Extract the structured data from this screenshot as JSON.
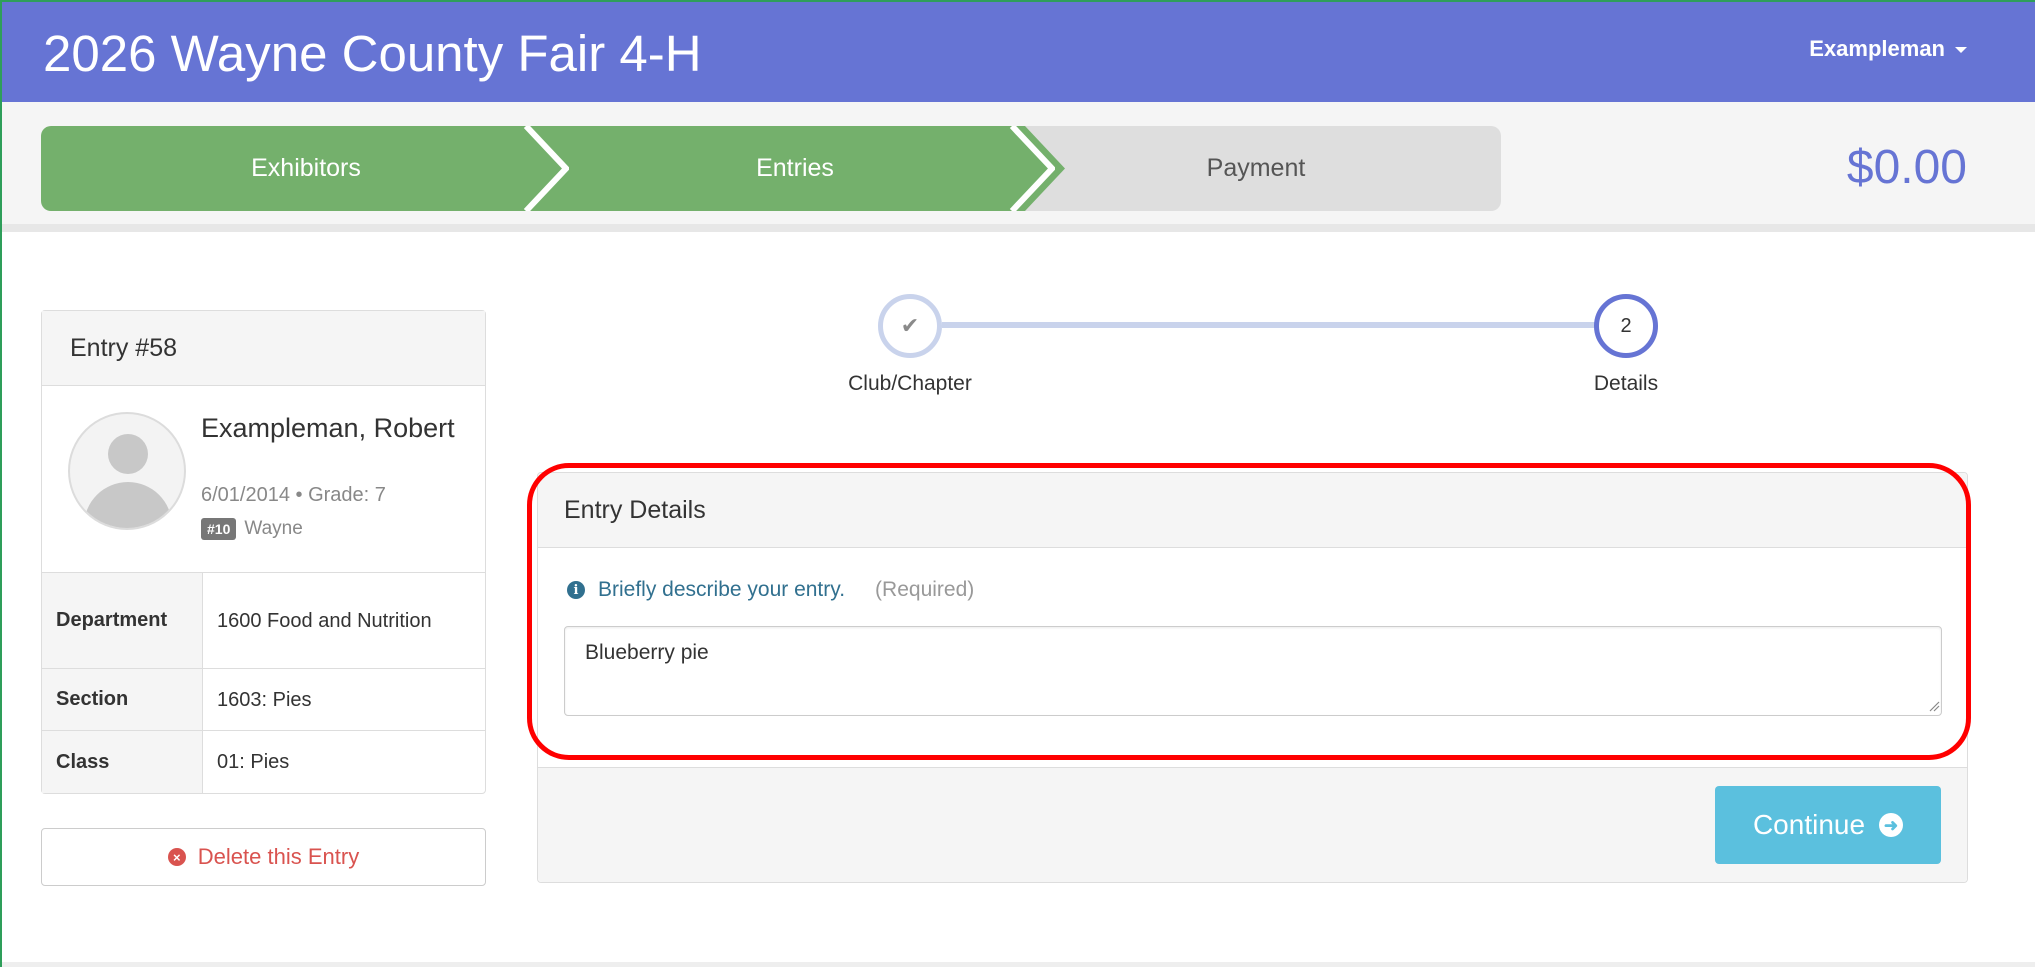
{
  "header": {
    "title": "2026 Wayne County Fair 4-H",
    "user_name": "Exampleman",
    "bg_color": "#6674d4"
  },
  "progress": {
    "steps": [
      {
        "label": "Exhibitors",
        "state": "complete"
      },
      {
        "label": "Entries",
        "state": "current"
      },
      {
        "label": "Payment",
        "state": "pending"
      }
    ],
    "total": "$0.00",
    "complete_color": "#74b06c",
    "pending_color": "#dedede"
  },
  "entry": {
    "heading": "Entry #58",
    "exhibitor": {
      "name": "Exampleman, Robert",
      "meta": "6/01/2014 • Grade: 7",
      "club_number": "#10",
      "club_name": "Wayne"
    },
    "fields": [
      {
        "label": "Department",
        "value": "1600 Food and Nutrition"
      },
      {
        "label": "Section",
        "value": "1603: Pies"
      },
      {
        "label": "Class",
        "value": "01: Pies"
      }
    ],
    "delete_label": "Delete this Entry"
  },
  "wizard": {
    "steps": [
      {
        "label": "Club/Chapter",
        "marker": "✔",
        "state": "complete"
      },
      {
        "label": "Details",
        "marker": "2",
        "state": "current"
      }
    ]
  },
  "details": {
    "heading": "Entry Details",
    "prompt": "Briefly describe your entry.",
    "required": "(Required)",
    "description_value": "Blueberry pie",
    "continue_label": "Continue",
    "accent": "#5bc0de",
    "highlight_color": "#ff0000"
  }
}
